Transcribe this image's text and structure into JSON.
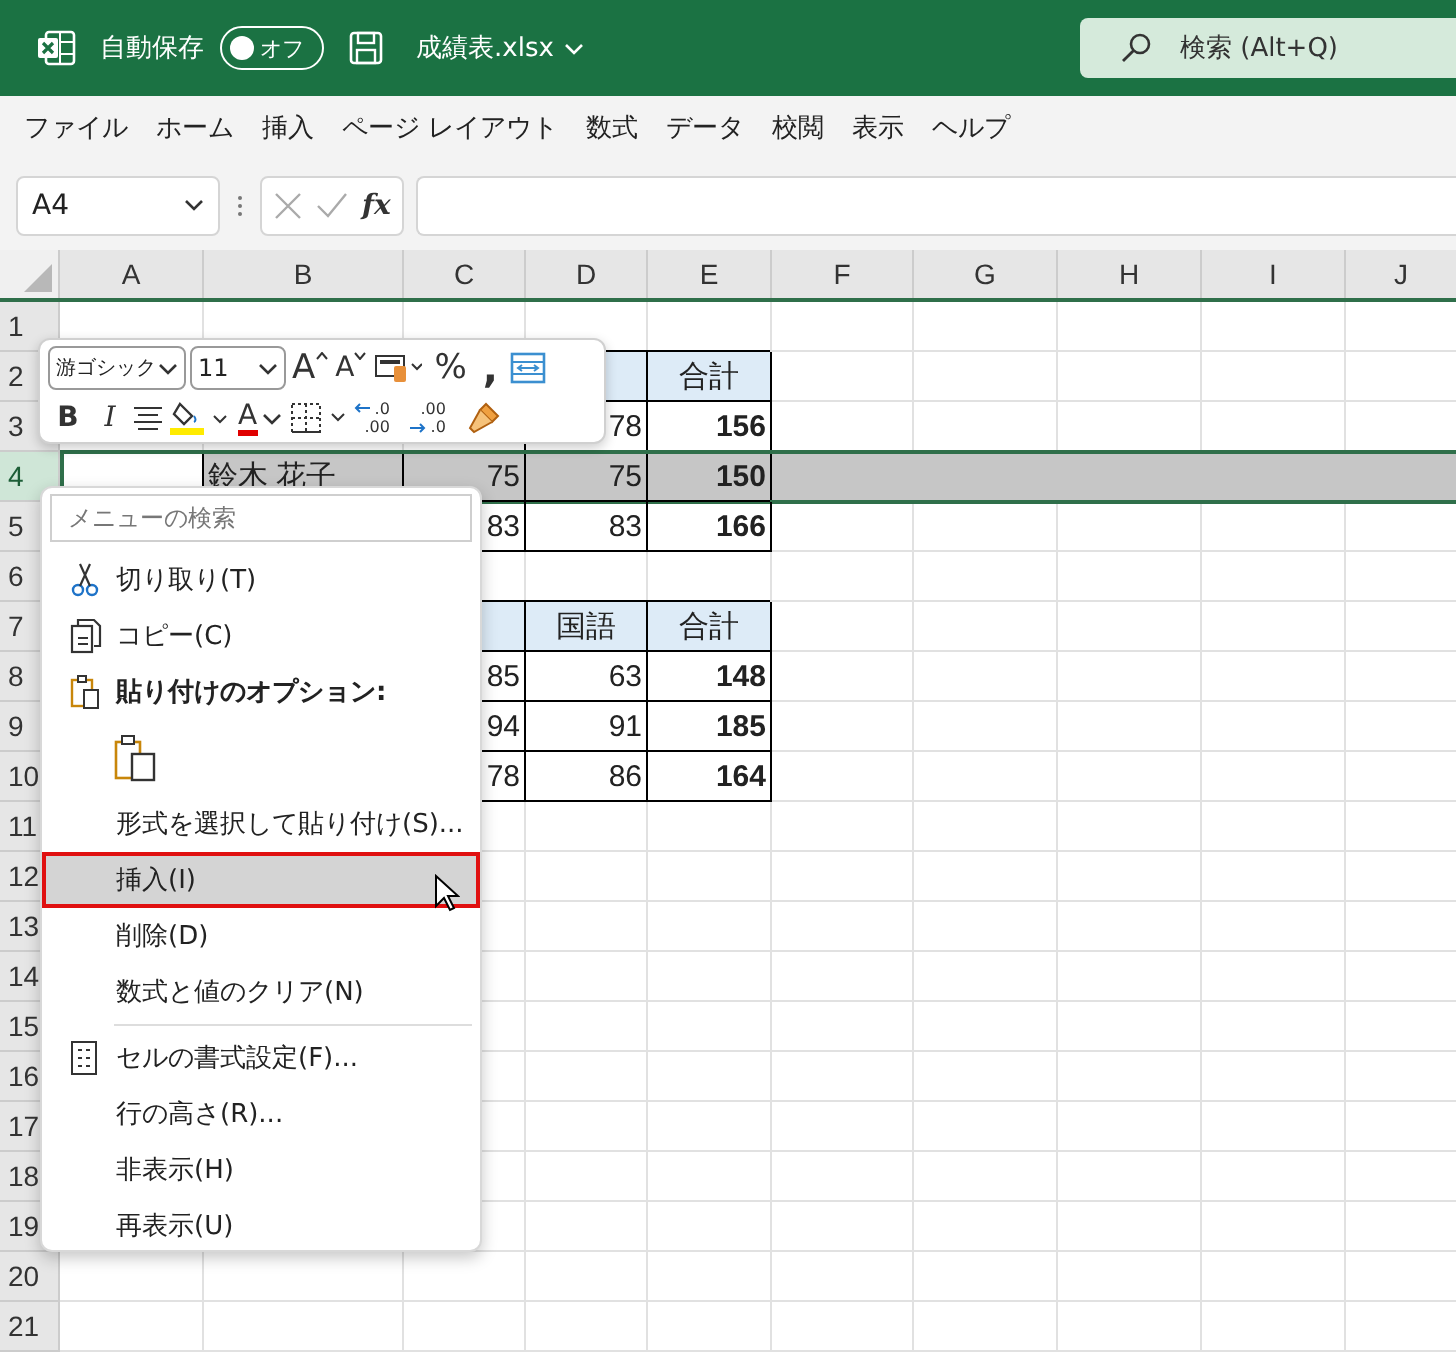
{
  "title_bar": {
    "autosave_label": "自動保存",
    "autosave": {
      "label": "オフ",
      "on": false
    },
    "filename": "成績表.xlsx",
    "search": {
      "placeholder": "検索 (Alt+Q)"
    }
  },
  "ribbon_tabs": [
    {
      "label": "ファイル",
      "selected": false
    },
    {
      "label": "ホーム",
      "selected": false
    },
    {
      "label": "挿入",
      "selected": false
    },
    {
      "label": "ページ レイアウト",
      "selected": false
    },
    {
      "label": "数式",
      "selected": false
    },
    {
      "label": "データ",
      "selected": false
    },
    {
      "label": "校閲",
      "selected": false
    },
    {
      "label": "表示",
      "selected": false
    },
    {
      "label": "ヘルプ",
      "selected": false
    }
  ],
  "formula_bar": {
    "name_box": "A4",
    "function_label": "fx"
  },
  "grid": {
    "columns": [
      "A",
      "B",
      "C",
      "D",
      "E",
      "F",
      "G",
      "H",
      "I",
      "J"
    ],
    "rows": [
      {
        "label": "1",
        "selected": false
      },
      {
        "label": "2",
        "selected": false,
        "cells": [
          null,
          null,
          null,
          {
            "kind": "header"
          },
          {
            "kind": "header",
            "text": "合計"
          }
        ]
      },
      {
        "label": "3",
        "selected": false,
        "cells": [
          null,
          null,
          null,
          {
            "kind": "value",
            "text": "78"
          },
          {
            "kind": "total",
            "text": "156"
          }
        ]
      },
      {
        "label": "4",
        "selected": true,
        "cells": [
          {
            "kind": "blank",
            "active": true
          },
          {
            "kind": "name",
            "text": "鈴木 花子"
          },
          {
            "kind": "value",
            "text": "75"
          },
          {
            "kind": "value",
            "text": "75"
          },
          {
            "kind": "total",
            "text": "150"
          }
        ]
      },
      {
        "label": "5",
        "selected": false,
        "cells": [
          null,
          null,
          {
            "kind": "value",
            "text": "83"
          },
          {
            "kind": "value",
            "text": "83"
          },
          {
            "kind": "total",
            "text": "166"
          }
        ]
      },
      {
        "label": "6",
        "selected": false
      },
      {
        "label": "7",
        "selected": false,
        "cells": [
          null,
          null,
          {
            "kind": "header"
          },
          {
            "kind": "header",
            "text": "国語"
          },
          {
            "kind": "header",
            "text": "合計"
          }
        ]
      },
      {
        "label": "8",
        "selected": false,
        "cells": [
          null,
          null,
          {
            "kind": "value",
            "text": "85"
          },
          {
            "kind": "value",
            "text": "63"
          },
          {
            "kind": "total",
            "text": "148"
          }
        ]
      },
      {
        "label": "9",
        "selected": false,
        "cells": [
          null,
          null,
          {
            "kind": "value",
            "text": "94"
          },
          {
            "kind": "value",
            "text": "91"
          },
          {
            "kind": "total",
            "text": "185"
          }
        ]
      },
      {
        "label": "10",
        "selected": false,
        "cells": [
          null,
          null,
          {
            "kind": "value",
            "text": "78"
          },
          {
            "kind": "value",
            "text": "86"
          },
          {
            "kind": "total",
            "text": "164"
          }
        ]
      },
      {
        "label": "11",
        "selected": false
      },
      {
        "label": "12",
        "selected": false
      },
      {
        "label": "13",
        "selected": false
      },
      {
        "label": "14",
        "selected": false
      },
      {
        "label": "15",
        "selected": false
      },
      {
        "label": "16",
        "selected": false
      },
      {
        "label": "17",
        "selected": false
      },
      {
        "label": "18",
        "selected": false
      },
      {
        "label": "19",
        "selected": false
      },
      {
        "label": "20",
        "selected": false
      },
      {
        "label": "21",
        "selected": false
      }
    ]
  },
  "mini_toolbar": {
    "font_name": "游ゴシック",
    "font_size": "11",
    "grow_font": "A",
    "shrink_font": "A",
    "percent": "%",
    "comma": ",",
    "bold": "B",
    "italic": "I",
    "font_color": "A",
    "increase_decimal": {
      "top": ".0",
      "bottom": ".00"
    },
    "decrease_decimal": {
      "top": ".00",
      "bottom": ".0"
    }
  },
  "context_menu": {
    "search": {
      "placeholder": "メニューの検索"
    },
    "items": [
      {
        "kind": "cut",
        "label": "切り取り(T)",
        "selected": false
      },
      {
        "kind": "copy",
        "label": "コピー(C)",
        "selected": false
      },
      {
        "kind": "paste-header",
        "label": "貼り付けのオプション:"
      },
      {
        "kind": "paste-option"
      },
      {
        "kind": "command",
        "label": "形式を選択して貼り付け(S)...",
        "selected": false
      },
      {
        "kind": "command",
        "label": "挿入(I)",
        "selected": true
      },
      {
        "kind": "command",
        "label": "削除(D)",
        "selected": false
      },
      {
        "kind": "command",
        "label": "数式と値のクリア(N)",
        "selected": false
      },
      {
        "kind": "separator"
      },
      {
        "kind": "format-cells",
        "label": "セルの書式設定(F)...",
        "selected": false
      },
      {
        "kind": "command",
        "label": "行の高さ(R)...",
        "selected": false
      },
      {
        "kind": "command",
        "label": "非表示(H)",
        "selected": false
      },
      {
        "kind": "command",
        "label": "再表示(U)",
        "selected": false
      }
    ]
  }
}
